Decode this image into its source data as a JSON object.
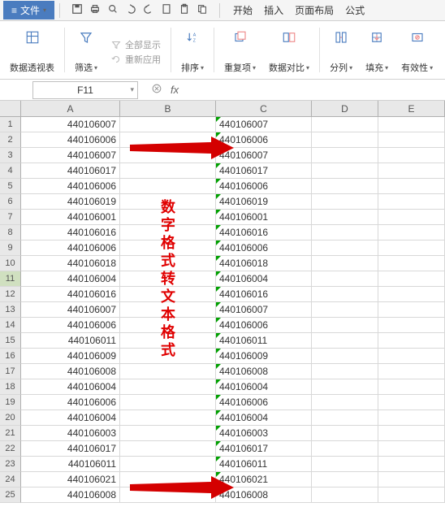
{
  "menubar": {
    "file_label": "文件",
    "tabs": [
      "开始",
      "插入",
      "页面布局",
      "公式"
    ]
  },
  "ribbon": {
    "pivot_label": "数据透视表",
    "filter_label": "筛选",
    "show_all": "全部显示",
    "reapply": "重新应用",
    "sort_label": "排序",
    "dup_label": "重复项",
    "compare_label": "数据对比",
    "split_label": "分列",
    "fill_label": "填充",
    "validate_label": "有效性"
  },
  "ref": {
    "name": "F11"
  },
  "columns": [
    "A",
    "B",
    "C",
    "D",
    "E"
  ],
  "rows": [
    {
      "n": 1,
      "a": "440106007",
      "c": "440106007"
    },
    {
      "n": 2,
      "a": "440106006",
      "c": "440106006"
    },
    {
      "n": 3,
      "a": "440106007",
      "c": "440106007"
    },
    {
      "n": 4,
      "a": "440106017",
      "c": "440106017"
    },
    {
      "n": 5,
      "a": "440106006",
      "c": "440106006"
    },
    {
      "n": 6,
      "a": "440106019",
      "c": "440106019"
    },
    {
      "n": 7,
      "a": "440106001",
      "c": "440106001"
    },
    {
      "n": 8,
      "a": "440106016",
      "c": "440106016"
    },
    {
      "n": 9,
      "a": "440106006",
      "c": "440106006"
    },
    {
      "n": 10,
      "a": "440106018",
      "c": "440106018"
    },
    {
      "n": 11,
      "a": "440106004",
      "c": "440106004",
      "sel": true
    },
    {
      "n": 12,
      "a": "440106016",
      "c": "440106016"
    },
    {
      "n": 13,
      "a": "440106007",
      "c": "440106007"
    },
    {
      "n": 14,
      "a": "440106006",
      "c": "440106006"
    },
    {
      "n": 15,
      "a": "440106011",
      "c": "440106011"
    },
    {
      "n": 16,
      "a": "440106009",
      "c": "440106009"
    },
    {
      "n": 17,
      "a": "440106008",
      "c": "440106008"
    },
    {
      "n": 18,
      "a": "440106004",
      "c": "440106004"
    },
    {
      "n": 19,
      "a": "440106006",
      "c": "440106006"
    },
    {
      "n": 20,
      "a": "440106004",
      "c": "440106004"
    },
    {
      "n": 21,
      "a": "440106003",
      "c": "440106003"
    },
    {
      "n": 22,
      "a": "440106017",
      "c": "440106017"
    },
    {
      "n": 23,
      "a": "440106011",
      "c": "440106011"
    },
    {
      "n": 24,
      "a": "440106021",
      "c": "440106021"
    },
    {
      "n": 25,
      "a": "440106008",
      "c": "440106008"
    }
  ],
  "annotation": {
    "vertical_text": "数字格式转文本格式"
  }
}
